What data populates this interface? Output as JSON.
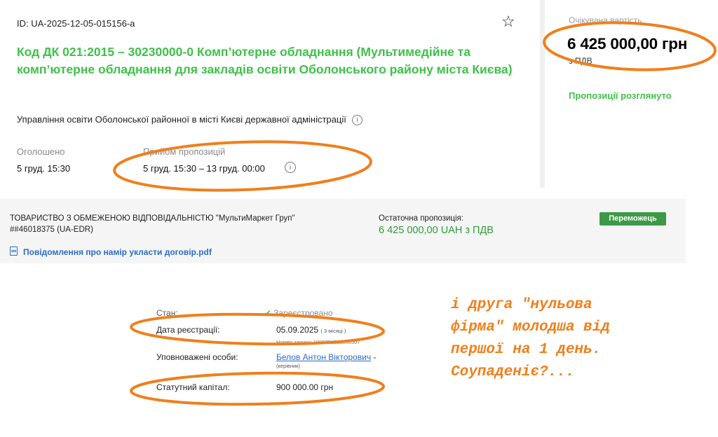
{
  "tender": {
    "id": "ID: UA-2025-12-05-015156-a",
    "title": "Код ДК 021:2015 – 30230000-0 Комп’ютерне обладнання (Мультимедійне та комп’ютерне обладнання для закладів освіти Оболонського району міста Києва)",
    "organization": "Управління освіти Оболонської районної в місті Києві державної адміністрації",
    "announced_label": "Оголошено",
    "announced_value": "5 груд. 15:30",
    "bids_label": "Прийом пропозицій",
    "bids_value": "5 груд. 15:30 – 13 груд. 00:00",
    "star_icon": "star-outline-icon",
    "info_icon": "info-circle-icon"
  },
  "summary": {
    "expected_label": "Очікувана вартість",
    "expected_amount": "6 425 000,00 грн",
    "vat_label": "з ПДВ",
    "status": "Пропозиції розглянуто"
  },
  "bidder": {
    "name": "ТОВАРИСТВО З ОБМЕЖЕНОЮ ВІДПОВІДАЛЬНІСТЮ \"МультиМаркет Груп\"",
    "edr": "##46018375 (UA-EDR)",
    "final_label": "Остаточна пропозиція:",
    "final_value": "6 425 000,00 UAH з ПДВ",
    "badge": "Переможець",
    "doc_link": "Повідомлення про намір укласти договір.pdf",
    "doc_icon": "file-icon"
  },
  "registry": {
    "status_label": "Стан:",
    "status_value": "Зареєстровано",
    "reg_date_label": "Дата реєстрації:",
    "reg_date_value": "05.09.2025",
    "reg_date_age": "( 3 місяці )",
    "reg_number": "Номер запису: 1000731020000507",
    "authorized_label": "Уповноважені особи:",
    "authorized_name": "Белов Антон Вікторович",
    "authorized_suffix": " -",
    "authorized_role": "(керівник)",
    "capital_label": "Статутний капітал:",
    "capital_value": "900 000.00 грн"
  },
  "annotation": {
    "line1": "і друга \"нульова",
    "line2": "фірма\" молодша від",
    "line3": "першої на 1 день.",
    "line4": "Соупаденіє?..."
  },
  "colors": {
    "accent_green": "#3fc14a",
    "winner_green": "#3c9a46",
    "link_blue": "#2a6cc7",
    "annotation_orange": "#f07f1c"
  }
}
